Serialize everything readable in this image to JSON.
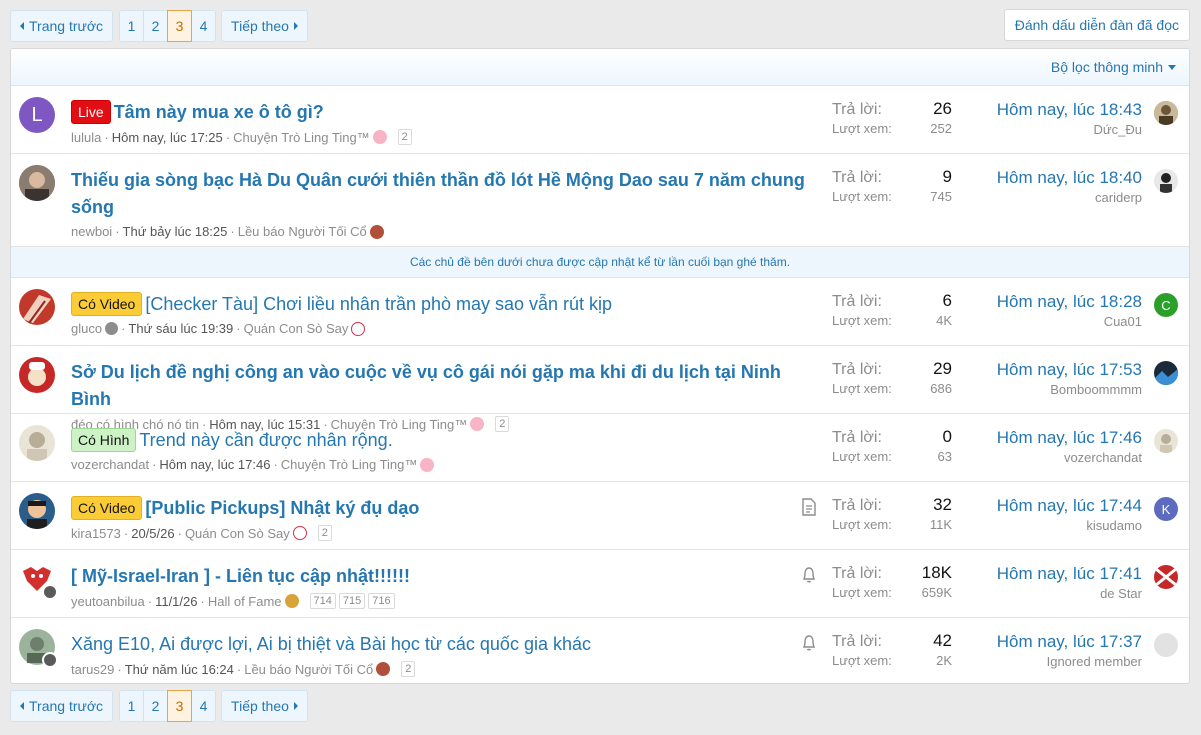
{
  "pagination": {
    "prev_label": "Trang trước",
    "next_label": "Tiếp theo",
    "pages": [
      "1",
      "2",
      "3",
      "4"
    ],
    "current": "3"
  },
  "mark_read_label": "Đánh dấu diễn đàn đã đọc",
  "filter_label": "Bộ lọc thông minh",
  "unread_notice": "Các chủ đề bên dưới chưa được cập nhật kể từ lần cuối bạn ghé thăm.",
  "stats_labels": {
    "replies": "Trả lời:",
    "views": "Lượt xem:"
  },
  "threads": [
    {
      "prefix": "Live",
      "title": "Tâm này mua xe ô tô gì?",
      "author": "lulula",
      "date": "Hôm nay, lúc 17:25",
      "forum": "Chuyện Trò Ling Ting™",
      "pages": [
        "2"
      ],
      "replies": "26",
      "views": "252",
      "last_time": "Hôm nay, lúc 18:43",
      "last_user": "Dức_Đu",
      "avatar_letter": "L",
      "avatar_color": "#7e57c2"
    },
    {
      "prefix": "",
      "title": "Thiếu gia sòng bạc Hà Du Quân cưới thiên thần đồ lót Hề Mộng Dao sau 7 năm chung sống",
      "author": "newboi",
      "date": "Thứ bảy lúc 18:25",
      "forum": "Lều báo Người Tối Cổ",
      "pages": [],
      "replies": "9",
      "views": "745",
      "last_time": "Hôm nay, lúc 18:40",
      "last_user": "cariderp"
    },
    {
      "prefix": "Có Video",
      "title": "[Checker Tàu] Chơi liều nhân trần phò may sao vẫn rút kịp",
      "author": "gluco",
      "date": "Thứ sáu lúc 19:39",
      "forum": "Quán Con Sò Say",
      "pages": [],
      "replies": "6",
      "views": "4K",
      "last_time": "Hôm nay, lúc 18:28",
      "last_user": "Cua01",
      "last_avatar_letter": "C",
      "last_avatar_color": "#2aa02a"
    },
    {
      "prefix": "",
      "title": "Sở Du lịch đề nghị công an vào cuộc về vụ cô gái nói gặp ma khi đi du lịch tại Ninh Bình",
      "author": "đéo có hình chó nó tin",
      "date": "Hôm nay, lúc 15:31",
      "forum": "Chuyện Trò Ling Ting™",
      "pages": [
        "2"
      ],
      "replies": "29",
      "views": "686",
      "last_time": "Hôm nay, lúc 17:53",
      "last_user": "Bomboommmm"
    },
    {
      "prefix": "Có Hình",
      "title": "Trend này cần được nhân rộng.",
      "author": "vozerchandat",
      "date": "Hôm nay, lúc 17:46",
      "forum": "Chuyện Trò Ling Ting™",
      "pages": [],
      "replies": "0",
      "views": "63",
      "last_time": "Hôm nay, lúc 17:46",
      "last_user": "vozerchandat"
    },
    {
      "prefix": "Có Video",
      "title": "[Public Pickups] Nhật ký đụ dạo",
      "author": "kira1573",
      "date": "20/5/26",
      "forum": "Quán Con Sò Say",
      "pages": [
        "2"
      ],
      "replies": "32",
      "views": "11K",
      "last_time": "Hôm nay, lúc 17:44",
      "last_user": "kisudamo",
      "last_avatar_letter": "K",
      "last_avatar_color": "#5c6bc0"
    },
    {
      "prefix": "",
      "title": "[ Mỹ-Israel-Iran ] - Liên tục cập nhật!!!!!!",
      "author": "yeutoanbilua",
      "date": "11/1/26",
      "forum": "Hall of Fame",
      "pages": [
        "714",
        "715",
        "716"
      ],
      "replies": "18K",
      "views": "659K",
      "last_time": "Hôm nay, lúc 17:41",
      "last_user": "de Star"
    },
    {
      "prefix": "",
      "title": "Xăng E10, Ai được lợi, Ai bị thiệt và Bài học từ các quốc gia khác",
      "author": "tarus29",
      "date": "Thứ năm lúc 16:24",
      "forum": "Lều báo Người Tối Cổ",
      "pages": [
        "2"
      ],
      "replies": "42",
      "views": "2K",
      "last_time": "Hôm nay, lúc 17:37",
      "last_user": "Ignored member"
    }
  ]
}
